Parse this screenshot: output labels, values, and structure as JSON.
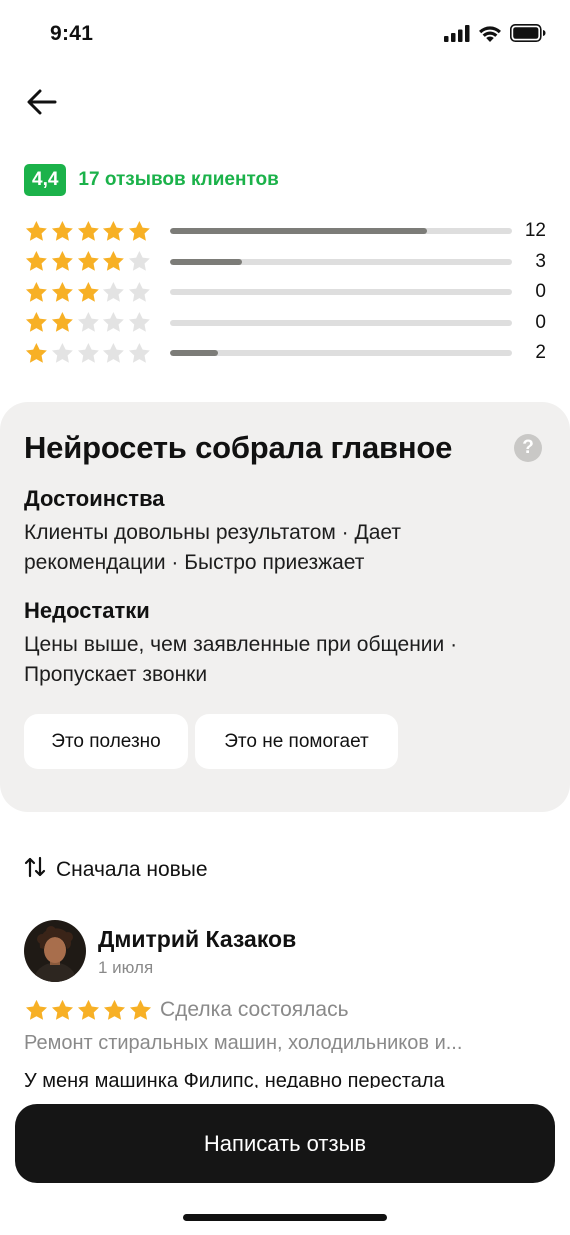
{
  "status_bar": {
    "time": "9:41",
    "icons": [
      "cellular-signal-icon",
      "wifi-icon",
      "battery-icon"
    ]
  },
  "header": {
    "back_icon": "arrow-left-icon"
  },
  "rating_summary": {
    "score": "4,4",
    "reviews_label": "17 отзывов клиентов",
    "accent_color": "#1bb24a",
    "rows": [
      {
        "stars": 5,
        "count": "12",
        "share": 0.75
      },
      {
        "stars": 4,
        "count": "3",
        "share": 0.21
      },
      {
        "stars": 3,
        "count": "0",
        "share": 0
      },
      {
        "stars": 2,
        "count": "0",
        "share": 0
      },
      {
        "stars": 1,
        "count": "2",
        "share": 0.14
      }
    ]
  },
  "ai_summary": {
    "title": "Нейросеть собрала главное",
    "help_icon": "question-circle-icon",
    "pros_title": "Достоинства",
    "pros_text": "Клиенты довольны результатом · Дает рекомендации · Быстро приезжает",
    "cons_title": "Недостатки",
    "cons_text": "Цены выше, чем заявленные при общении · Пропускает звонки",
    "useful_label": "Это полезно",
    "not_helpful_label": "Это не помогает"
  },
  "sort": {
    "icon": "sort-arrows-icon",
    "label": "Сначала новые"
  },
  "reviews": [
    {
      "name": "Дмитрий Казаков",
      "date": "1 июля",
      "stars": 5,
      "status": "Сделка состоялась",
      "service": "Ремонт стиральных машин, холодильников и...",
      "text": "У меня машинка Филипс, недавно перестала"
    }
  ],
  "footer": {
    "write_review_label": "Написать отзыв"
  },
  "colors": {
    "star_filled": "#f7b025",
    "star_empty": "#e3e3e3",
    "card_background": "#f1f0ef",
    "button_dark": "#151515"
  }
}
